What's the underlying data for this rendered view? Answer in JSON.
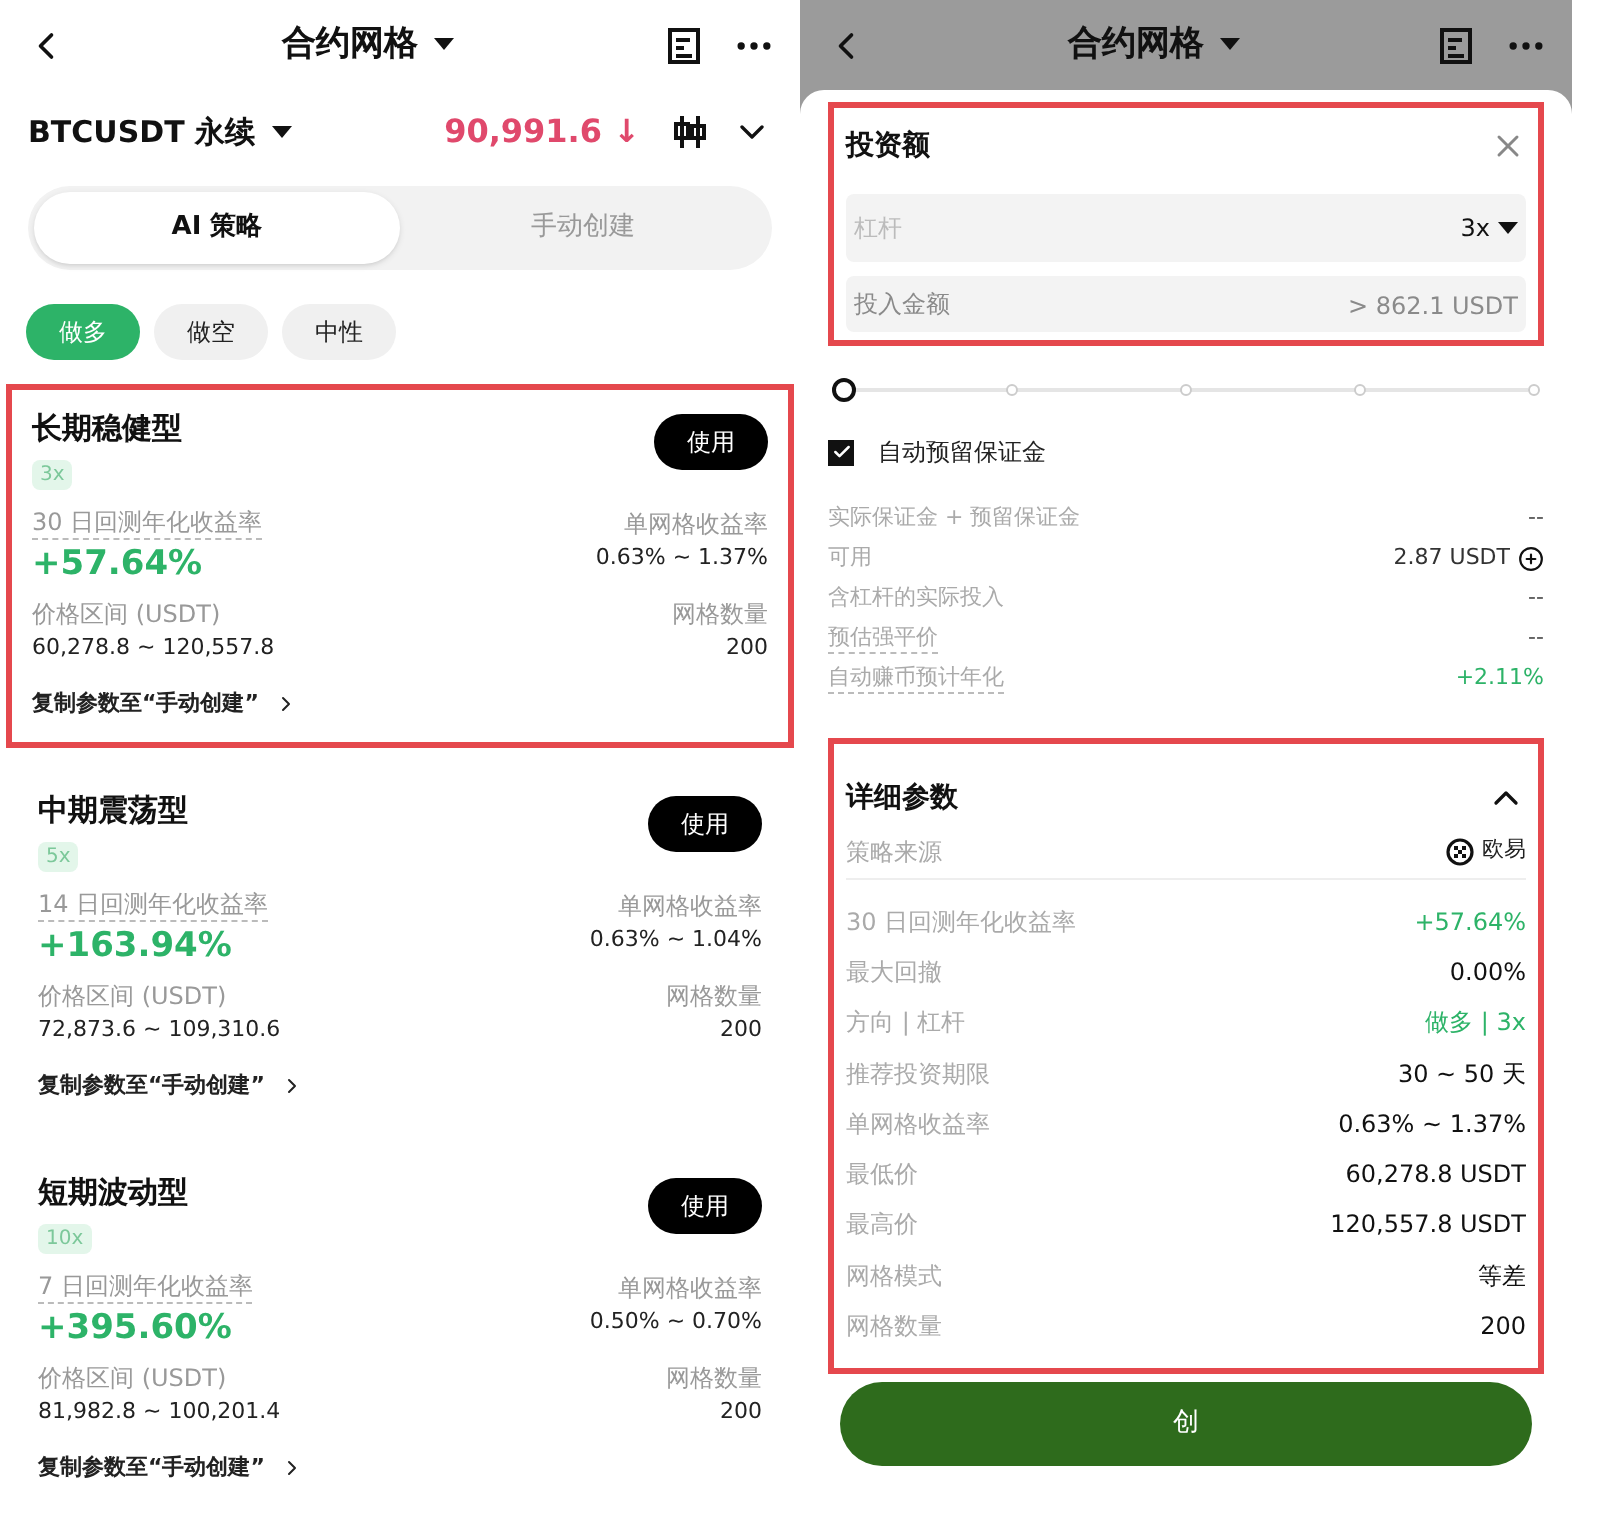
{
  "left": {
    "header": {
      "title": "合约网格"
    },
    "ticker": {
      "symbol": "BTCUSDT 永续",
      "price": "90,991.6 ↓"
    },
    "mode_tabs": [
      {
        "label": "AI 策略",
        "selected": true
      },
      {
        "label": "手动创建",
        "selected": false
      }
    ],
    "direction_chips": [
      {
        "label": "做多",
        "selected": true
      },
      {
        "label": "做空",
        "selected": false
      },
      {
        "label": "中性",
        "selected": false
      }
    ],
    "strategies": [
      {
        "name": "长期稳健型",
        "leverage": "3x",
        "use_button": "使用",
        "return_label": "30 日回测年化收益率",
        "return_value": "+57.64%",
        "grid_return_label": "单网格收益率",
        "grid_return_value": "0.63% ~ 1.37%",
        "range_label": "价格区间 (USDT)",
        "range_value": "60,278.8 ~ 120,557.8",
        "grid_count_label": "网格数量",
        "grid_count_value": "200",
        "copy_link": "复制参数至“手动创建”",
        "highlighted": true
      },
      {
        "name": "中期震荡型",
        "leverage": "5x",
        "use_button": "使用",
        "return_label": "14 日回测年化收益率",
        "return_value": "+163.94%",
        "grid_return_label": "单网格收益率",
        "grid_return_value": "0.63% ~ 1.04%",
        "range_label": "价格区间 (USDT)",
        "range_value": "72,873.6 ~ 109,310.6",
        "grid_count_label": "网格数量",
        "grid_count_value": "200",
        "copy_link": "复制参数至“手动创建”",
        "highlighted": false
      },
      {
        "name": "短期波动型",
        "leverage": "10x",
        "use_button": "使用",
        "return_label": "7 日回测年化收益率",
        "return_value": "+395.60%",
        "grid_return_label": "单网格收益率",
        "grid_return_value": "0.50% ~ 0.70%",
        "range_label": "价格区间 (USDT)",
        "range_value": "81,982.8 ~ 100,201.4",
        "grid_count_label": "网格数量",
        "grid_count_value": "200",
        "copy_link": "复制参数至“手动创建”",
        "highlighted": false
      }
    ]
  },
  "right": {
    "header": {
      "title": "合约网格"
    },
    "investment": {
      "title": "投资额",
      "highlighted": true,
      "leverage_label": "杠杆",
      "leverage_value": "3x",
      "amount_placeholder": "投入金额",
      "amount_hint": "> 862.1 USDT"
    },
    "slider": {
      "level": 0
    },
    "auto_margin": {
      "label": "自动预留保证金",
      "checked": true
    },
    "info_rows": [
      {
        "label": "实际保证金 + 预留保证金",
        "value": "--",
        "kind": "plain",
        "dashed": false
      },
      {
        "label": "可用",
        "value": "2.87 USDT",
        "kind": "balance",
        "dashed": false
      },
      {
        "label": "含杠杆的实际投入",
        "value": "--",
        "kind": "plain",
        "dashed": false
      },
      {
        "label": "预估强平价",
        "value": "--",
        "kind": "plain",
        "dashed": true
      },
      {
        "label": "自动赚币预计年化",
        "value": "+2.11%",
        "kind": "positive",
        "dashed": true
      }
    ],
    "details": {
      "title": "详细参数",
      "expanded": true,
      "highlighted": true,
      "source_label": "策略来源",
      "source_value": "欧易",
      "rows": [
        {
          "label": "30 日回测年化收益率",
          "value": "+57.64%",
          "kind": "positive"
        },
        {
          "label": "最大回撤",
          "value": "0.00%",
          "kind": "plain"
        },
        {
          "label": "方向 | 杠杆",
          "value": "做多 | 3x",
          "kind": "positive"
        },
        {
          "label": "推荐投资期限",
          "value": "30 ~ 50 天",
          "kind": "plain"
        },
        {
          "label": "单网格收益率",
          "value": "0.63% ~ 1.37%",
          "kind": "plain"
        },
        {
          "label": "最低价",
          "value": "60,278.8 USDT",
          "kind": "plain"
        },
        {
          "label": "最高价",
          "value": "120,557.8 USDT",
          "kind": "plain"
        },
        {
          "label": "网格模式",
          "value": "等差",
          "kind": "plain"
        },
        {
          "label": "网格数量",
          "value": "200",
          "kind": "plain"
        }
      ]
    },
    "create_button": "创"
  }
}
